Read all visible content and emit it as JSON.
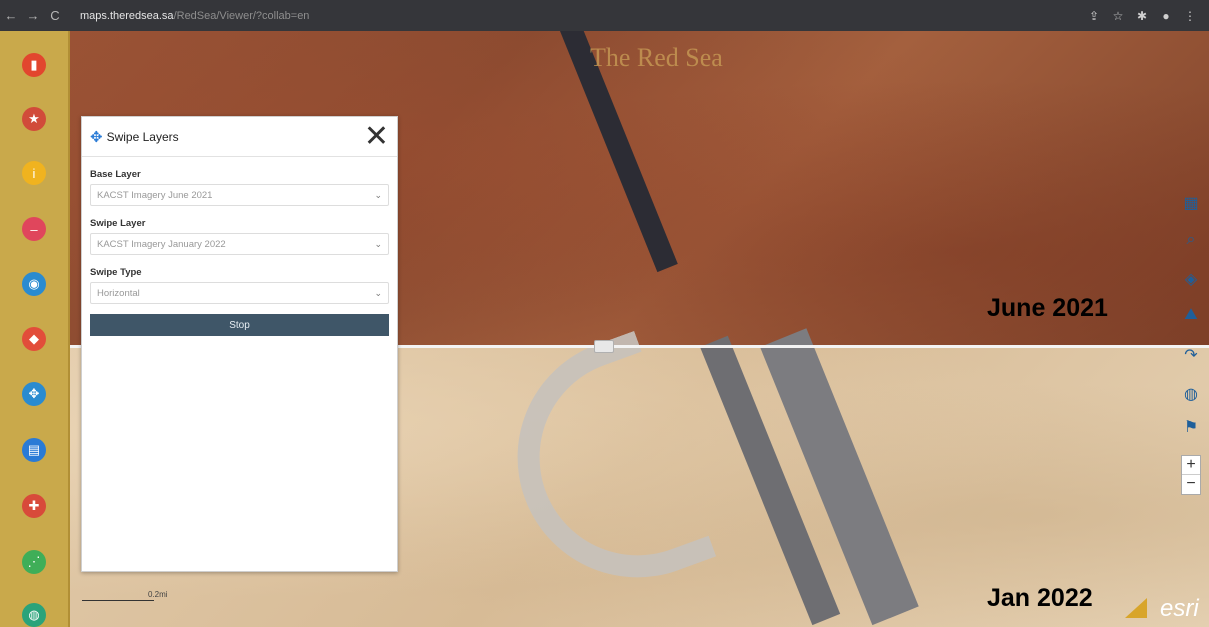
{
  "browser": {
    "url_domain": "maps.theredsea.sa",
    "url_path": "/RedSea/Viewer/?collab=en",
    "back": "←",
    "forward": "→",
    "reload": "C",
    "lock": "🔒",
    "right_icons": [
      "share-icon",
      "star-icon",
      "extension-icon",
      "profile-icon",
      "menu-icon"
    ]
  },
  "map": {
    "watermark": "The Red Sea",
    "label_top": "June 2021",
    "label_bottom": "Jan 2022",
    "scale_label": "0.2mi",
    "attribution": "esri"
  },
  "sidebar": {
    "tools": [
      {
        "name": "bookmark-tool",
        "color": "#e2462e",
        "glyph": "▮"
      },
      {
        "name": "legend-tool",
        "color": "#d14b3a",
        "glyph": "★"
      },
      {
        "name": "info-tool",
        "color": "#f0b31f",
        "glyph": "i"
      },
      {
        "name": "layers-remove-tool",
        "color": "#e0465c",
        "glyph": "–"
      },
      {
        "name": "identify-tool",
        "color": "#2a8bd0",
        "glyph": "◉"
      },
      {
        "name": "layer-list-tool",
        "color": "#e24d3a",
        "glyph": "◆"
      },
      {
        "name": "swipe-tool",
        "color": "#2a8bd0",
        "glyph": "✥"
      },
      {
        "name": "print-tool",
        "color": "#2a7bd6",
        "glyph": "▤"
      },
      {
        "name": "query-tool",
        "color": "#d84a3a",
        "glyph": "✚"
      },
      {
        "name": "share-tool",
        "color": "#3fae58",
        "glyph": "⋰"
      },
      {
        "name": "basemap-tool",
        "color": "#2aa37a",
        "glyph": "◍"
      }
    ]
  },
  "panel": {
    "title": "Swipe Layers",
    "close": "✕",
    "base_layer_label": "Base Layer",
    "base_layer_value": "KACST Imagery June 2021",
    "swipe_layer_label": "Swipe Layer",
    "swipe_layer_value": "KACST Imagery January 2022",
    "swipe_type_label": "Swipe Type",
    "swipe_type_value": "Horizontal",
    "stop_label": "Stop"
  },
  "right_tools": {
    "zoom_in": "+",
    "zoom_out": "−",
    "icons": [
      "grid-icon",
      "search-icon",
      "compass-icon",
      "terrain-icon",
      "redo-icon",
      "globe-icon",
      "flag-icon"
    ]
  }
}
